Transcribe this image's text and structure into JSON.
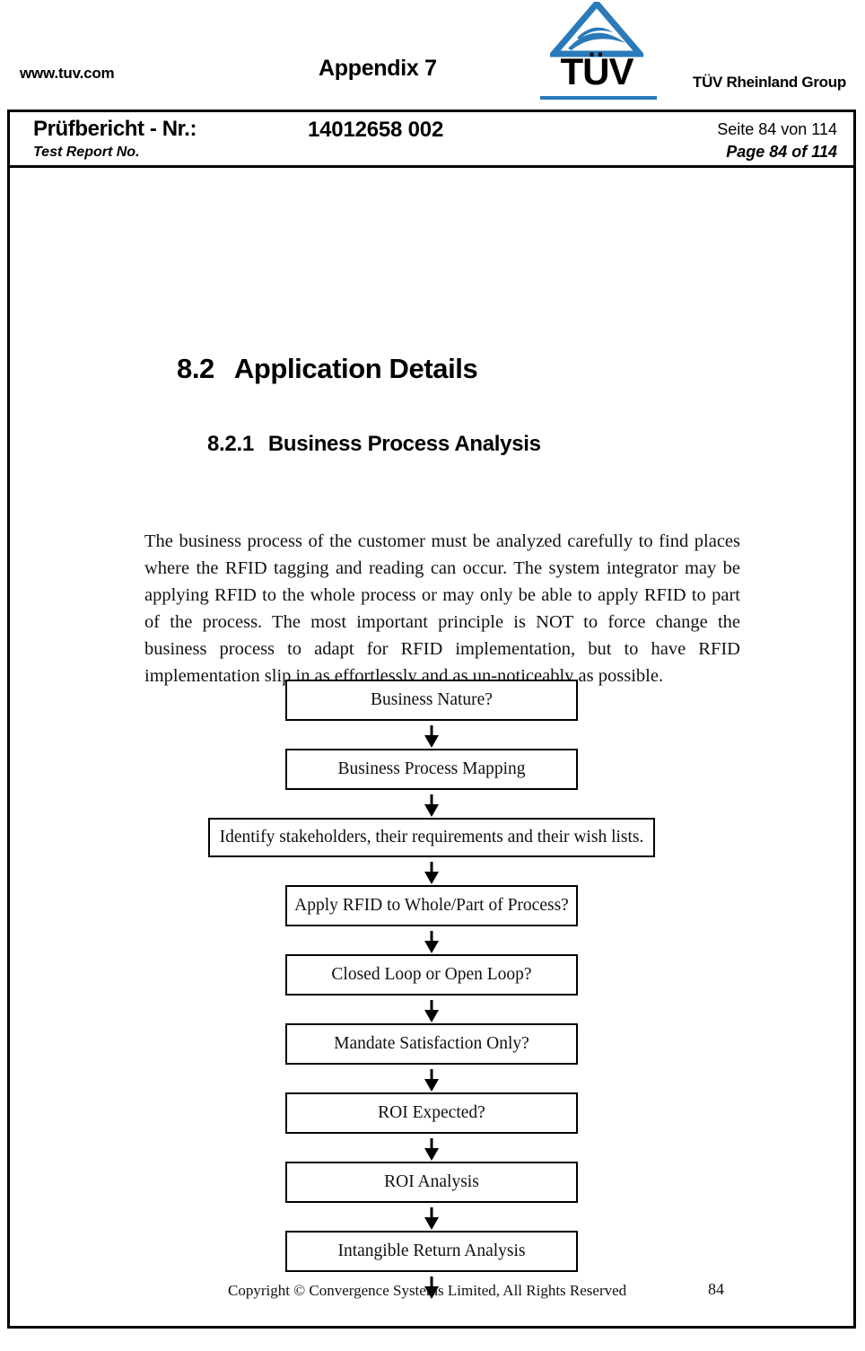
{
  "masthead": {
    "site_url": "www.tuv.com",
    "appendix_title": "Appendix 7",
    "logo_wordmark": "TÜV",
    "group_label": "TÜV Rheinland Group",
    "logo_icon": "tuv-triangle-logo",
    "accent_color": "#2a7ab9"
  },
  "report_header": {
    "label_de": "Prüfbericht - Nr.:",
    "label_en": "Test Report No.",
    "report_number": "14012658 002",
    "page_info_de": "Seite 84 von 114",
    "page_info_en": "Page 84 of 114"
  },
  "content": {
    "heading_section": {
      "number": "8.2",
      "text": "Application Details"
    },
    "heading_subsection": {
      "number": "8.2.1",
      "text": "Business Process Analysis"
    },
    "paragraph": "The business process of the customer must be analyzed carefully to find places where the RFID tagging and reading can occur.   The system integrator may be applying RFID to the whole process or may only be able to apply RFID to part of the process.  The most important principle is NOT to force change the business process to adapt for RFID implementation, but to have RFID implementation slip in as effortlessly and as un-noticeably as possible."
  },
  "flowchart": {
    "type": "vertical-sequence",
    "steps": [
      {
        "label": "Business Nature?",
        "width": "narrow"
      },
      {
        "label": "Business Process Mapping",
        "width": "narrow"
      },
      {
        "label": "Identify stakeholders, their requirements and their wish lists.",
        "width": "wide"
      },
      {
        "label": "Apply RFID to Whole/Part of Process?",
        "width": "narrow"
      },
      {
        "label": "Closed Loop or Open Loop?",
        "width": "narrow"
      },
      {
        "label": "Mandate Satisfaction Only?",
        "width": "narrow"
      },
      {
        "label": "ROI Expected?",
        "width": "narrow"
      },
      {
        "label": "ROI Analysis",
        "width": "narrow"
      },
      {
        "label": "Intangible Return Analysis",
        "width": "narrow"
      }
    ],
    "trailing_arrow": true
  },
  "footer": {
    "copyright": "Copyright © Convergence Systems Limited, All Rights Reserved",
    "page_number": "84"
  }
}
